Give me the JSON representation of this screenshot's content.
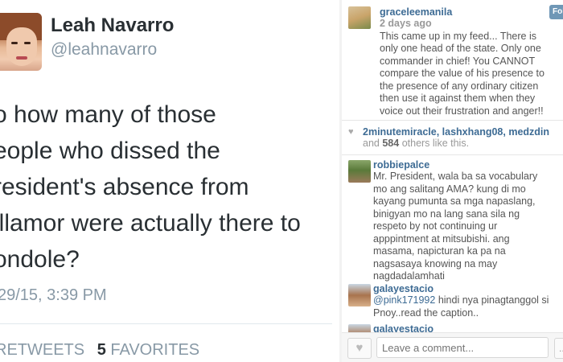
{
  "tweet": {
    "name": "Leah Navarro",
    "handle": "@leahnavarro",
    "text_lines": [
      "o how many of those",
      "eople who dissed the",
      "resident's absence from",
      "illamor were actually there to",
      "ondole?"
    ],
    "timestamp": "29/15, 3:39 PM",
    "retweets_label": "RETWEETS",
    "favorites_count": "5",
    "favorites_label": "FAVORITES"
  },
  "instagram": {
    "follow_label": "Fol",
    "top_comment": {
      "user": "graceleemanila",
      "time": "2 days ago",
      "lines": [
        "This came up in my feed... There is",
        "only one head of the state. Only one",
        "commander in chief! You CANNOT",
        "compare the value of his presence to",
        "the presence of any ordinary citizen",
        "then use it against them when they",
        "voice out their frustration and anger!!"
      ]
    },
    "likes": {
      "names": "2minutemiracle, lashxhang08, medzdin",
      "and_label": "and",
      "count": "584",
      "tail": "others like this."
    },
    "comments": [
      {
        "user": "robbiepalce",
        "lines": [
          "Mr. President, wala ba sa vocabulary",
          "mo ang salitang AMA? kung di mo",
          "kayang pumunta sa mga napaslang,",
          "binigyan mo na lang sana sila ng",
          "respeto by not continuing ur",
          "apppintment at mitsubishi. ang",
          "masama, napicturan ka pa na",
          "nagsasaya knowing na may",
          "nagdadalamhati"
        ]
      },
      {
        "user": "galayestacio",
        "mention": "@pink171992",
        "lines": [
          " hindi nya pinagtanggol si",
          "Pnoy..read the caption.."
        ]
      },
      {
        "user": "galayestacio",
        "lines": []
      }
    ],
    "footer": {
      "comment_placeholder": "Leave a comment...",
      "more_label": "..."
    },
    "colors": {
      "username": "#3d6b94",
      "follow": "#6f97b6"
    }
  }
}
